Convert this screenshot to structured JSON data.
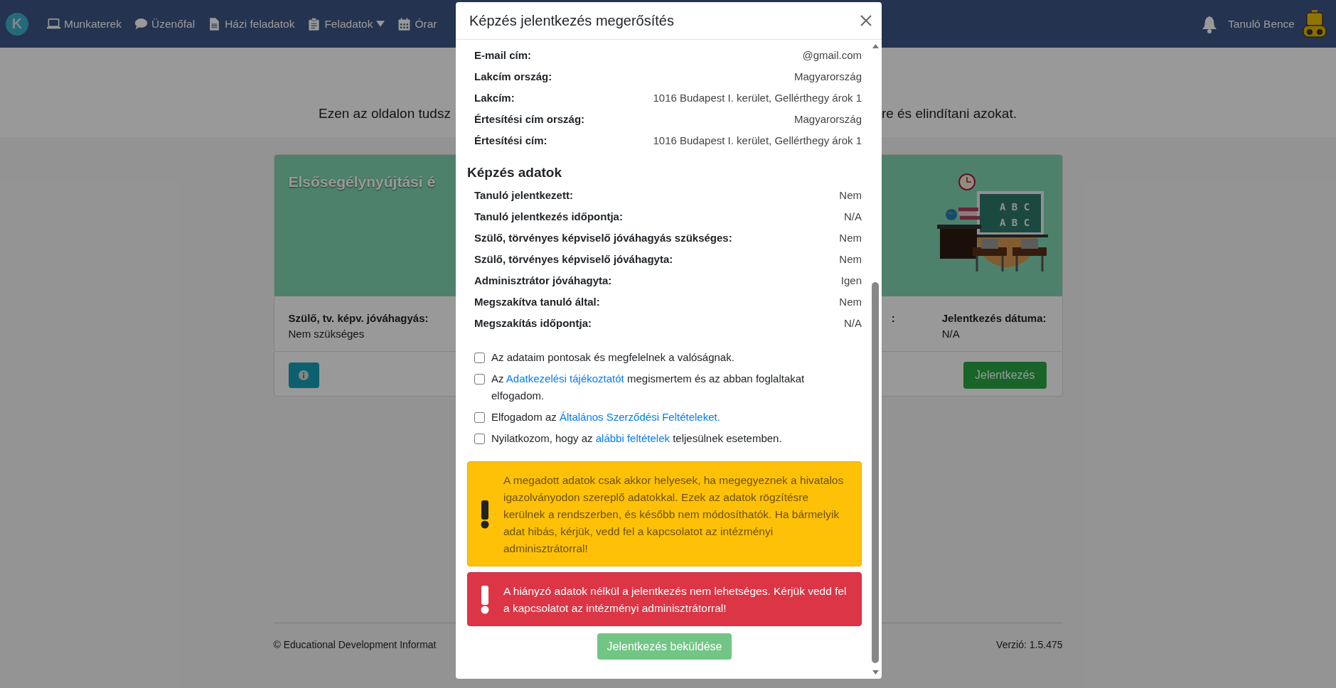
{
  "nav": {
    "logo": "K",
    "items": [
      {
        "label": "Munkaterek",
        "dropdown": false
      },
      {
        "label": "Üzenőfal",
        "dropdown": false
      },
      {
        "label": "Házi feladatok",
        "dropdown": false
      },
      {
        "label": "Feladatok",
        "dropdown": true
      },
      {
        "label": "Órar",
        "dropdown": false
      }
    ],
    "user_name": "Tanuló Bence"
  },
  "intro": {
    "text_left": "Ezen az oldalon tudsz",
    "text_right": "re és elindítani azokat."
  },
  "card": {
    "title": "Elsősegélynyújtási é",
    "board_lines": [
      "A B C",
      "A B C"
    ],
    "fields": [
      {
        "label": "Szülő, tv. képv. jóváhagyás:",
        "value": "Nem szükséges"
      },
      {
        "label": ":"
      },
      {
        "label": "Jelentkezés dátuma:",
        "value": "N/A"
      }
    ],
    "apply_button": "Jelentkezés"
  },
  "footer": {
    "copyright": "© Educational Development Informat",
    "version": "Verzió: 1.5.475"
  },
  "modal": {
    "title": "Képzés jelentkezés megerősítés",
    "personal_rows": [
      {
        "label": "E-mail cím:",
        "value": "@gmail.com"
      },
      {
        "label": "Lakcím ország:",
        "value": "Magyarország"
      },
      {
        "label": "Lakcím:",
        "value": "1016 Budapest I. kerület, Gellérthegy árok 1"
      },
      {
        "label": "Értesítési cím ország:",
        "value": "Magyarország"
      },
      {
        "label": "Értesítési cím:",
        "value": "1016 Budapest I. kerület, Gellérthegy árok 1"
      }
    ],
    "section_title": "Képzés adatok",
    "course_rows": [
      {
        "label": "Tanuló jelentkezett:",
        "value": "Nem"
      },
      {
        "label": "Tanuló jelentkezés időpontja:",
        "value": "N/A"
      },
      {
        "label": "Szülő, törvényes képviselő jóváhagyás szükséges:",
        "value": "Nem"
      },
      {
        "label": "Szülő, törvényes képviselő jóváhagyta:",
        "value": "Nem"
      },
      {
        "label": "Adminisztrátor jóváhagyta:",
        "value": "Igen"
      },
      {
        "label": "Megszakítva tanuló által:",
        "value": "Nem"
      },
      {
        "label": "Megszakítás időpontja:",
        "value": "N/A"
      }
    ],
    "checkboxes": [
      {
        "checked": false,
        "parts": [
          {
            "text": "Az adataim pontosak és megfelelnek a valóságnak.",
            "kind": "text"
          }
        ]
      },
      {
        "checked": false,
        "parts": [
          {
            "text": "Az ",
            "kind": "text"
          },
          {
            "text": "Adatkezelési tájékoztatót",
            "kind": "link"
          },
          {
            "text": " megismertem és az abban foglaltakat elfogadom.",
            "kind": "text"
          }
        ]
      },
      {
        "checked": false,
        "parts": [
          {
            "text": "Elfogadom az ",
            "kind": "text"
          },
          {
            "text": "Általános Szerződési Feltételeket.",
            "kind": "link"
          }
        ]
      },
      {
        "checked": false,
        "parts": [
          {
            "text": "Nyilatkozom, hogy az ",
            "kind": "text"
          },
          {
            "text": "alábbi feltételek",
            "kind": "link"
          },
          {
            "text": " teljesülnek esetemben.",
            "kind": "text"
          }
        ]
      }
    ],
    "alerts": [
      {
        "kind": "warning",
        "text": "A megadott adatok csak akkor helyesek, ha megegyeznek a hivatalos igazolványodon szereplő adatokkal. Ezek az adatok rögzítésre kerülnek a rendszerben, és később nem módosíthatók. Ha bármelyik adat hibás, kérjük, vedd fel a kapcsolatot az intézményi adminisztrátorral!"
      },
      {
        "kind": "danger",
        "text": "A hiányzó adatok nélkül a jelentkezés nem lehetséges. Kérjük vedd fel a kapcsolatot az intézményi adminisztrátorral!"
      }
    ],
    "submit_button": {
      "label": "Jelentkezés beküldése",
      "disabled": true
    }
  }
}
